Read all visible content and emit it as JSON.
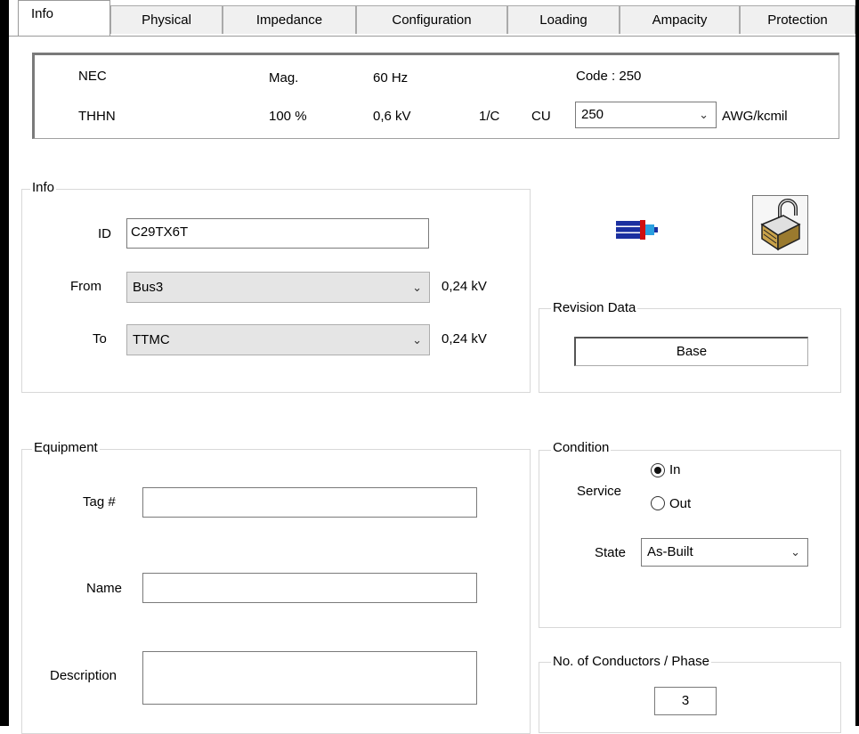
{
  "tabs": [
    "Info",
    "Physical",
    "Impedance",
    "Configuration",
    "Loading",
    "Ampacity",
    "Protection"
  ],
  "header": {
    "standard": "NEC",
    "magnetic": "Mag.",
    "frequency": "60 Hz",
    "code": "Code : 250",
    "insulation": "THHN",
    "percent": "100 %",
    "voltage": "0,6 kV",
    "conductor_config": "1/C",
    "material": "CU",
    "size_value": "250",
    "size_unit": "AWG/kcmil"
  },
  "info_group": {
    "title": "Info",
    "id_label": "ID",
    "id_value": "C29TX6T",
    "from_label": "From",
    "from_value": "Bus3",
    "from_kv": "0,24 kV",
    "to_label": "To",
    "to_value": "TTMC",
    "to_kv": "0,24 kV"
  },
  "revision": {
    "title": "Revision Data",
    "value": "Base"
  },
  "equipment": {
    "title": "Equipment",
    "tag_label": "Tag #",
    "tag_value": "",
    "name_label": "Name",
    "name_value": "",
    "description_label": "Description",
    "description_value": ""
  },
  "condition": {
    "title": "Condition",
    "service_label": "Service",
    "option_in": "In",
    "option_out": "Out",
    "selected": "In",
    "state_label": "State",
    "state_value": "As-Built"
  },
  "conductors": {
    "title": "No. of Conductors / Phase",
    "value": "3"
  },
  "icons": [
    "cable-icon",
    "lock-icon"
  ],
  "colors": {
    "cable_blue": "#1a2fa0",
    "cable_red": "#d01010",
    "cable_cyan": "#2aa0e0"
  }
}
